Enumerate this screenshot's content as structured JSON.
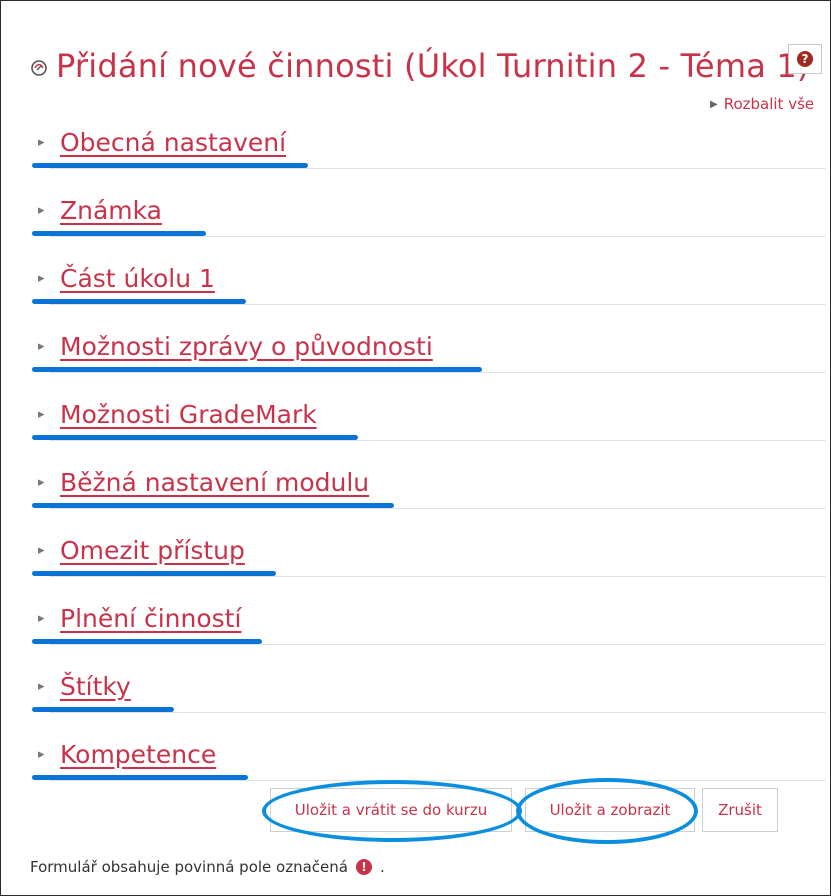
{
  "header": {
    "title": "Přidání nové činnosti (Úkol Turnitin 2 - Téma 1)",
    "help_icon": "question-circle-icon",
    "expand_all_label": "Rozbalit vše"
  },
  "sections": [
    {
      "label": "Obecná nastavení"
    },
    {
      "label": "Známka"
    },
    {
      "label": "Část úkolu 1"
    },
    {
      "label": "Možnosti zprávy o původnosti"
    },
    {
      "label": "Možnosti GradeMark"
    },
    {
      "label": "Běžná nastavení modulu"
    },
    {
      "label": "Omezit přístup"
    },
    {
      "label": "Plnění činností"
    },
    {
      "label": "Štítky"
    },
    {
      "label": "Kompetence"
    }
  ],
  "buttons": {
    "save_return": "Uložit a vrátit se do kurzu",
    "save_show": "Uložit a zobrazit",
    "cancel": "Zrušit"
  },
  "footer": {
    "required_note": "Formulář obsahuje povinná pole označená",
    "required_icon": "exclamation-circle-icon",
    "trailing": "."
  },
  "colors": {
    "link": "#c9334a",
    "annotation": "#0a74d6"
  }
}
